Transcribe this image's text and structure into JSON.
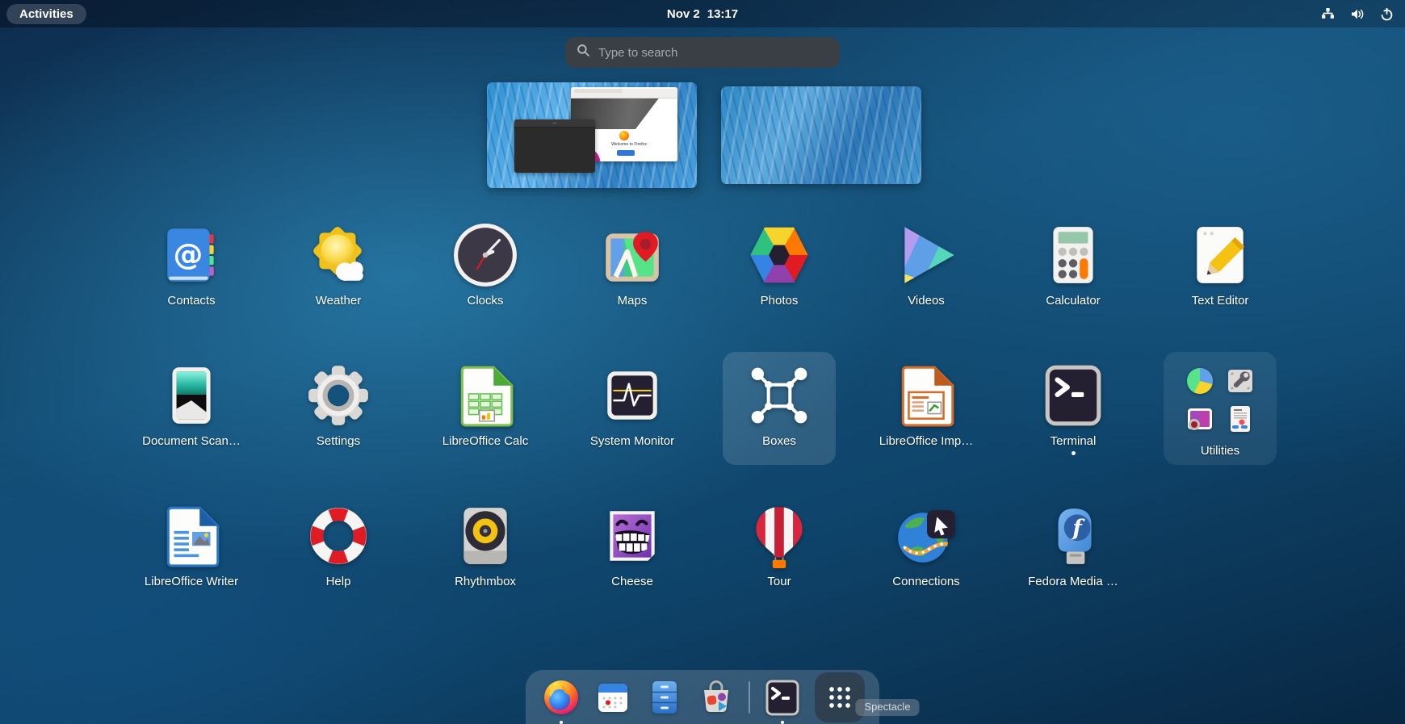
{
  "top_bar": {
    "activities_label": "Activities",
    "clock_date": "Nov 2",
    "clock_time": "13:17",
    "status_icons": [
      "network-wired-icon",
      "volume-icon",
      "power-icon"
    ]
  },
  "search": {
    "placeholder": "Type to search",
    "icon": "search-icon"
  },
  "workspaces": {
    "workspace1": {
      "windows": [
        "firefox",
        "terminal"
      ],
      "firefox_text": "Welcome to Firefox"
    },
    "workspace2": {
      "windows": []
    }
  },
  "app_grid": {
    "row1": [
      {
        "label": "Contacts",
        "icon": "contacts-icon"
      },
      {
        "label": "Weather",
        "icon": "weather-icon"
      },
      {
        "label": "Clocks",
        "icon": "clocks-icon"
      },
      {
        "label": "Maps",
        "icon": "maps-icon"
      },
      {
        "label": "Photos",
        "icon": "photos-icon"
      },
      {
        "label": "Videos",
        "icon": "videos-icon"
      },
      {
        "label": "Calculator",
        "icon": "calculator-icon"
      },
      {
        "label": "Text Editor",
        "icon": "text-editor-icon"
      }
    ],
    "row2": [
      {
        "label": "Document Scan…",
        "icon": "document-scanner-icon"
      },
      {
        "label": "Settings",
        "icon": "settings-icon"
      },
      {
        "label": "LibreOffice Calc",
        "icon": "libreoffice-calc-icon"
      },
      {
        "label": "System Monitor",
        "icon": "system-monitor-icon"
      },
      {
        "label": "Boxes",
        "icon": "boxes-icon",
        "selected": true
      },
      {
        "label": "LibreOffice Imp…",
        "icon": "libreoffice-impress-icon"
      },
      {
        "label": "Terminal",
        "icon": "terminal-icon",
        "running": true
      },
      {
        "label": "Utilities",
        "icon": "folder-icon",
        "folder_apps": [
          "usage-pie-icon",
          "disk-utility-icon",
          "screenshot-icon",
          "document-viewer-icon"
        ]
      }
    ],
    "row3": [
      {
        "label": "LibreOffice Writer",
        "icon": "libreoffice-writer-icon"
      },
      {
        "label": "Help",
        "icon": "help-icon"
      },
      {
        "label": "Rhythmbox",
        "icon": "rhythmbox-icon"
      },
      {
        "label": "Cheese",
        "icon": "cheese-icon"
      },
      {
        "label": "Tour",
        "icon": "tour-icon"
      },
      {
        "label": "Connections",
        "icon": "connections-icon"
      },
      {
        "label": "Fedora Media …",
        "icon": "fedora-media-writer-icon"
      }
    ]
  },
  "dock": {
    "items": [
      {
        "name": "firefox",
        "icon": "firefox-icon",
        "running": true
      },
      {
        "name": "calendar",
        "icon": "calendar-icon",
        "running": false
      },
      {
        "name": "files",
        "icon": "files-icon",
        "running": false
      },
      {
        "name": "software",
        "icon": "software-icon",
        "running": false
      },
      {
        "name": "terminal",
        "icon": "terminal-icon",
        "running": true
      },
      {
        "name": "app-grid",
        "icon": "app-grid-icon",
        "active": true
      }
    ],
    "tooltip": "Spectacle"
  },
  "colors": {
    "accent": "#3584e4",
    "selection_tile": "rgba(255,255,255,0.13)",
    "top_bar_bg": "rgba(6,18,36,0.6)",
    "search_bg": "#3a3f45"
  }
}
